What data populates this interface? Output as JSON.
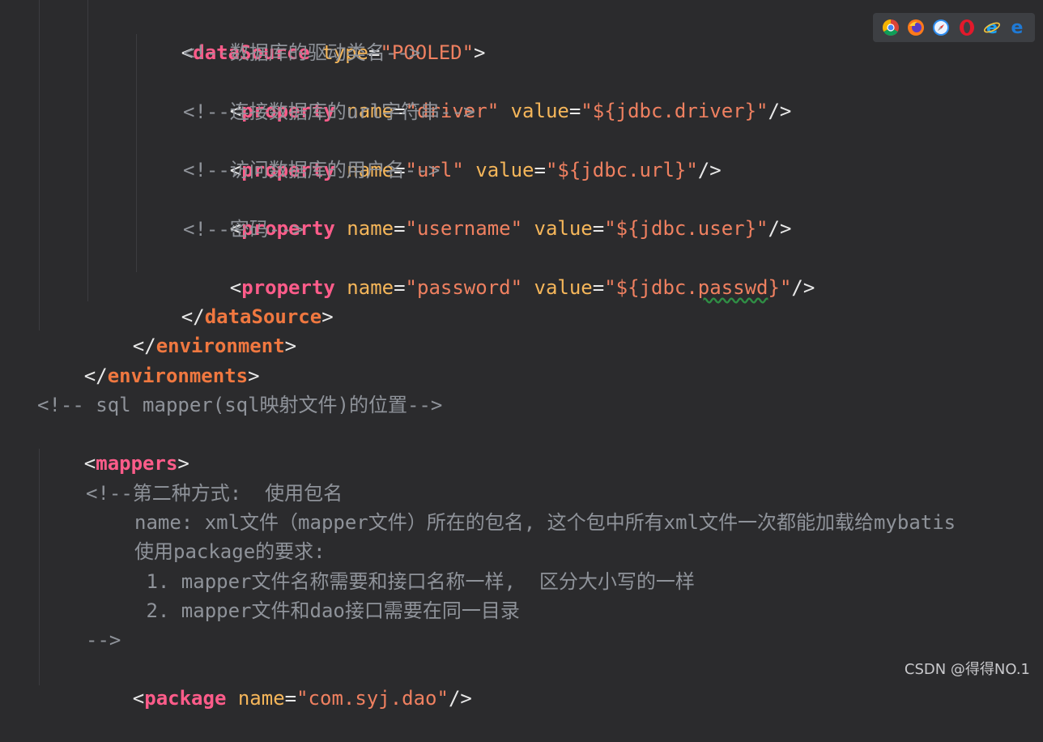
{
  "code": {
    "l1": {
      "open": "<",
      "tag": "dataSource",
      "attr1": "type",
      "eq": "=",
      "val1": "\"POOLED\"",
      "close": ">"
    },
    "l2": {
      "comment": "<!--数据库的驱动类名-->"
    },
    "l3": {
      "open": "<",
      "tag": "property",
      "attr1": "name",
      "val1": "\"driver\"",
      "attr2": "value",
      "val2": "\"${jdbc.driver}\"",
      "close": "/>"
    },
    "l4": {
      "comment": "<!--连接数据库的url字符串-->"
    },
    "l5": {
      "open": "<",
      "tag": "property",
      "attr1": "name",
      "val1": "\"url\"",
      "attr2": "value",
      "val2": "\"${jdbc.url}\"",
      "close": "/>"
    },
    "l6": {
      "comment": "<!--访问数据库的用户名-->"
    },
    "l7": {
      "open": "<",
      "tag": "property",
      "attr1": "name",
      "val1": "\"username\"",
      "attr2": "value",
      "val2": "\"${jdbc.user}\"",
      "close": "/>"
    },
    "l8": {
      "comment": "<!--密码-->"
    },
    "l9": {
      "open": "<",
      "tag": "property",
      "attr1": "name",
      "val1a": "\"password\"",
      "attr2": "value",
      "val2a": "\"${jdbc.",
      "val2b": "passwd",
      "val2c": "}\"",
      "close": "/>"
    },
    "l10": {
      "open": "</",
      "tag": "dataSource",
      "close": ">"
    },
    "l11": {
      "open": "</",
      "tag": "environment",
      "close": ">"
    },
    "l12": {
      "open": "</",
      "tag": "environments",
      "close": ">"
    },
    "l13": {
      "comment": "<!-- sql mapper(sql映射文件)的位置-->"
    },
    "l14": {
      "open": "<",
      "tag": "mappers",
      "close": ">"
    },
    "l15": {
      "comment": "<!--第二种方式:  使用包名"
    },
    "l16": {
      "comment": "name: xml文件（mapper文件）所在的包名, 这个包中所有xml文件一次都能加载给mybatis"
    },
    "l17": {
      "comment": "使用package的要求:"
    },
    "l18": {
      "comment": " 1. mapper文件名称需要和接口名称一样,  区分大小写的一样"
    },
    "l19": {
      "comment": " 2. mapper文件和dao接口需要在同一目录"
    },
    "l20": {
      "comment": "-->"
    },
    "l21": {
      "open": "<",
      "tag": "package",
      "attr1": "name",
      "val1": "\"com.syj.dao\"",
      "close": "/>"
    }
  },
  "browser_icons": [
    "chrome-icon",
    "firefox-icon",
    "safari-icon",
    "opera-icon",
    "ie-icon",
    "edge-icon"
  ],
  "watermark": "CSDN @得得NO.1",
  "colors": {
    "background": "#2b2b2d",
    "tag": "#ff5c8a",
    "attribute": "#f5b65a",
    "string": "#ef8060",
    "comment": "#8f939a"
  }
}
